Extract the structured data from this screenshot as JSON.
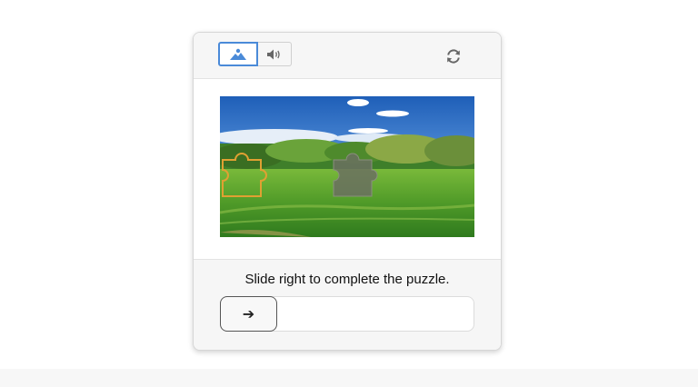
{
  "captcha": {
    "header": {
      "modes": [
        {
          "name": "image",
          "icon": "image-icon",
          "selected": true
        },
        {
          "name": "audio",
          "icon": "speaker-icon",
          "selected": false
        }
      ],
      "refresh_icon": "refresh-icon"
    },
    "puzzle": {
      "scene": "landscape-photo",
      "pieces": [
        "puzzle-piece-slot-icon",
        "puzzle-piece-target-icon"
      ]
    },
    "instruction": "Slide right to complete the puzzle.",
    "slider": {
      "handle_icon": "arrow-right-icon",
      "handle_glyph": "➔",
      "progress": 0
    },
    "colors": {
      "accent": "#4a8ad8",
      "piece_outline": "#e0a032",
      "header_bg": "#f6f6f6"
    }
  }
}
